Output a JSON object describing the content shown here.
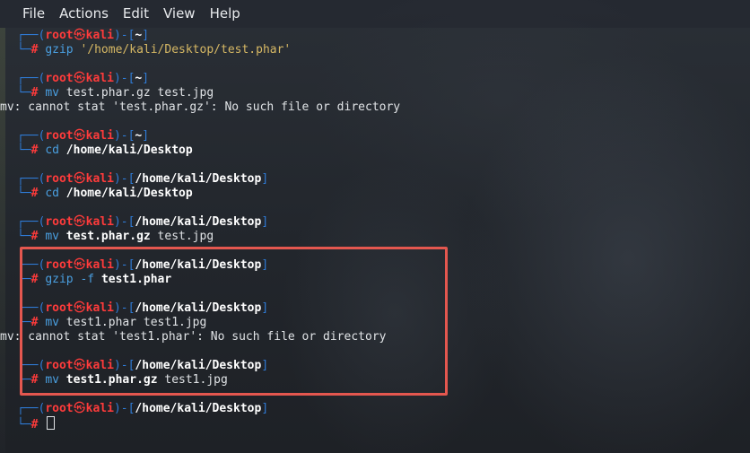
{
  "menu": {
    "items": [
      {
        "label": "File"
      },
      {
        "label": "Actions"
      },
      {
        "label": "Edit"
      },
      {
        "label": "View"
      },
      {
        "label": "Help"
      }
    ]
  },
  "prompt": {
    "open": "┌──(",
    "user": "root",
    "host": "kali",
    "mid": ")-[",
    "close": "]",
    "cmd_prefix": "└─",
    "hash": "#",
    "skull_icon": "skull-icon",
    "colors": {
      "blue": "#2f7bd6",
      "red": "#ff3b3b",
      "cmd": "#4a9fe0",
      "string": "#d6b864"
    }
  },
  "blocks": [
    {
      "cwd": "~",
      "parts": [
        {
          "t": "gzip",
          "c": "cmd"
        },
        {
          "t": " ",
          "c": "plain"
        },
        {
          "t": "'/home/kali/Desktop/test.phar'",
          "c": "str"
        }
      ],
      "output": ""
    },
    {
      "cwd": "~",
      "parts": [
        {
          "t": "mv",
          "c": "cmd"
        },
        {
          "t": " test.phar.gz test.jpg",
          "c": "plain"
        }
      ],
      "output": "mv: cannot stat 'test.phar.gz': No such file or directory"
    },
    {
      "cwd": "~",
      "parts": [
        {
          "t": "cd",
          "c": "cmd"
        },
        {
          "t": " ",
          "c": "plain"
        },
        {
          "t": "/home/kali/Desktop",
          "c": "bold"
        }
      ],
      "output": ""
    },
    {
      "cwd": "/home/kali/Desktop",
      "parts": [
        {
          "t": "cd",
          "c": "cmd"
        },
        {
          "t": " ",
          "c": "plain"
        },
        {
          "t": "/home/kali/Desktop",
          "c": "bold"
        }
      ],
      "output": ""
    },
    {
      "cwd": "/home/kali/Desktop",
      "parts": [
        {
          "t": "mv",
          "c": "cmd"
        },
        {
          "t": " ",
          "c": "plain"
        },
        {
          "t": "test.phar.gz",
          "c": "bold"
        },
        {
          "t": " test.jpg",
          "c": "plain"
        }
      ],
      "output": ""
    },
    {
      "cwd": "/home/kali/Desktop",
      "parts": [
        {
          "t": "gzip",
          "c": "cmd"
        },
        {
          "t": " -f ",
          "c": "cmd"
        },
        {
          "t": "test1.phar",
          "c": "bold"
        }
      ],
      "output": ""
    },
    {
      "cwd": "/home/kali/Desktop",
      "parts": [
        {
          "t": "mv",
          "c": "cmd"
        },
        {
          "t": " test1.phar test1.jpg",
          "c": "plain"
        }
      ],
      "output": "mv: cannot stat 'test1.phar': No such file or directory"
    },
    {
      "cwd": "/home/kali/Desktop",
      "parts": [
        {
          "t": "mv",
          "c": "cmd"
        },
        {
          "t": " ",
          "c": "plain"
        },
        {
          "t": "test1.phar.gz",
          "c": "bold"
        },
        {
          "t": " test1.jpg",
          "c": "plain"
        }
      ],
      "output": ""
    },
    {
      "cwd": "/home/kali/Desktop",
      "parts": [],
      "output": "",
      "active": true
    }
  ]
}
